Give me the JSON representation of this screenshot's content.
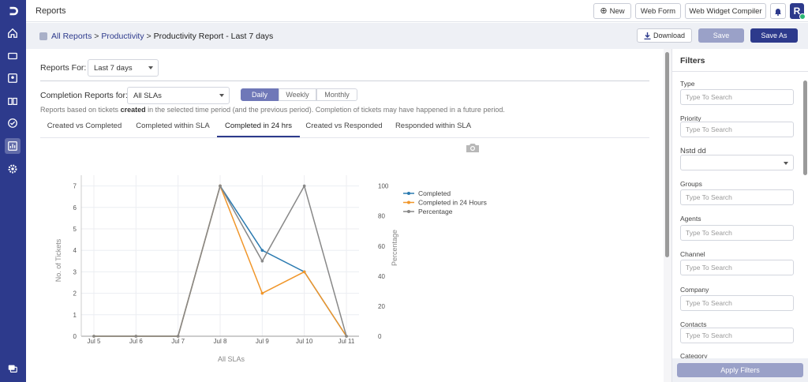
{
  "sidebar": {
    "icons": [
      "logo-icon",
      "home-icon",
      "ticket-icon",
      "contacts-icon",
      "knowledge-icon",
      "check-icon",
      "reports-icon",
      "settings-icon",
      "chat-icon"
    ]
  },
  "topbar": {
    "title": "Reports",
    "new_label": "New",
    "webform_label": "Web Form",
    "widget_label": "Web Widget Compiler",
    "avatar_initial": "R"
  },
  "breadcrumb": {
    "all_reports": "All Reports",
    "sep1": " > ",
    "productivity": "Productivity",
    "sep2": " > ",
    "current": "Productivity Report - Last 7 days"
  },
  "actions": {
    "download": "Download",
    "save": "Save",
    "save_as": "Save As"
  },
  "controls": {
    "reports_for_label": "Reports For:",
    "reports_for_value": "Last 7 days",
    "completion_label": "Completion Reports for:",
    "completion_value": "All SLAs",
    "period_tabs": [
      "Daily",
      "Weekly",
      "Monthly"
    ],
    "note_prefix": "Reports based on tickets ",
    "note_bold": "created",
    "note_suffix": " in the selected time period (and the previous period). Completion of tickets may have happened in a future period."
  },
  "tabs": [
    "Created vs Completed",
    "Completed within SLA",
    "Completed in 24 hrs",
    "Created vs Responded",
    "Responded within SLA"
  ],
  "chart_data": {
    "type": "line",
    "x": [
      "Jul 5",
      "Jul 6",
      "Jul 7",
      "Jul 8",
      "Jul 9",
      "Jul 10",
      "Jul 11"
    ],
    "xlabel": "All SLAs",
    "ylabel": "No. of Tickets",
    "y2label": "Percentage",
    "ylim": [
      0,
      7.5
    ],
    "y2lim": [
      0,
      100
    ],
    "yticks": [
      0,
      1,
      2,
      3,
      4,
      5,
      6,
      7
    ],
    "y2ticks": [
      0,
      20,
      40,
      60,
      80,
      100
    ],
    "grid": true,
    "legend": "top-right",
    "series": [
      {
        "name": "Completed",
        "color": "#2a7ab0",
        "axis": "left",
        "values": [
          0,
          0,
          0,
          7,
          4,
          3,
          0
        ]
      },
      {
        "name": "Completed in 24 Hours",
        "color": "#f0962a",
        "axis": "left",
        "values": [
          0,
          0,
          0,
          7,
          2,
          3,
          0
        ]
      },
      {
        "name": "Percentage",
        "color": "#888888",
        "axis": "right",
        "values": [
          0,
          0,
          0,
          100,
          50,
          100,
          0
        ]
      }
    ]
  },
  "filters": {
    "title": "Filters",
    "fields": [
      {
        "label": "Type",
        "placeholder": "Type To Search"
      },
      {
        "label": "Priority",
        "placeholder": "Type To Search"
      },
      {
        "label": "Nstd dd",
        "placeholder": ""
      },
      {
        "label": "Groups",
        "placeholder": "Type To Search"
      },
      {
        "label": "Agents",
        "placeholder": "Type To Search"
      },
      {
        "label": "Channel",
        "placeholder": "Type To Search"
      },
      {
        "label": "Company",
        "placeholder": "Type To Search"
      },
      {
        "label": "Contacts",
        "placeholder": "Type To Search"
      },
      {
        "label": "Category",
        "placeholder": ""
      }
    ],
    "apply_label": "Apply Filters"
  },
  "colors": {
    "brand": "#2d3a8c",
    "accent_light": "#9aa1c8"
  }
}
